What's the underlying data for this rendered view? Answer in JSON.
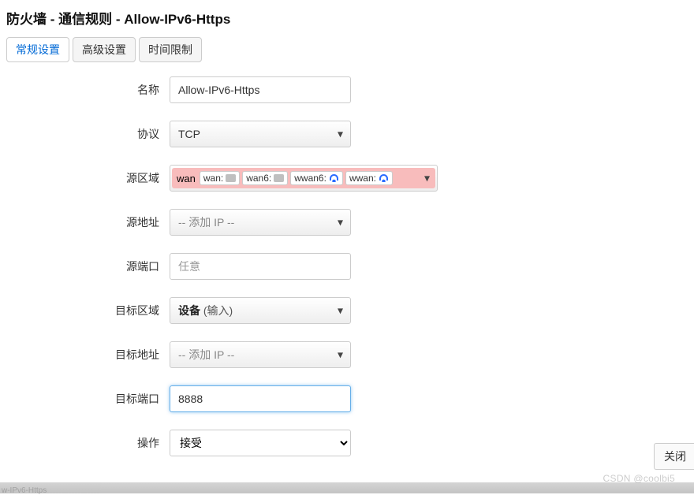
{
  "header": {
    "title": "防火墙 - 通信规则 - Allow-IPv6-Https"
  },
  "tabs": {
    "general": "常规设置",
    "advanced": "高级设置",
    "time": "时间限制"
  },
  "form": {
    "name": {
      "label": "名称",
      "value": "Allow-IPv6-Https"
    },
    "protocol": {
      "label": "协议",
      "value": "TCP"
    },
    "src_zone": {
      "label": "源区域",
      "zone": "wan",
      "ifaces": [
        {
          "name": "wan:",
          "type": "wired"
        },
        {
          "name": "wan6:",
          "type": "wired"
        },
        {
          "name": "wwan6:",
          "type": "wireless"
        },
        {
          "name": "wwan:",
          "type": "wireless"
        }
      ]
    },
    "src_addr": {
      "label": "源地址",
      "placeholder": "-- 添加 IP --"
    },
    "src_port": {
      "label": "源端口",
      "placeholder": "任意",
      "value": ""
    },
    "dst_zone": {
      "label": "目标区域",
      "value_bold": "设备",
      "value_inner": "(输入)"
    },
    "dst_addr": {
      "label": "目标地址",
      "placeholder": "-- 添加 IP --"
    },
    "dst_port": {
      "label": "目标端口",
      "value": "8888"
    },
    "action": {
      "label": "操作",
      "value": "接受"
    }
  },
  "buttons": {
    "close": "关闭"
  },
  "watermark": "CSDN @coolbi5",
  "bottomFaded": "w-IPv6-Https"
}
